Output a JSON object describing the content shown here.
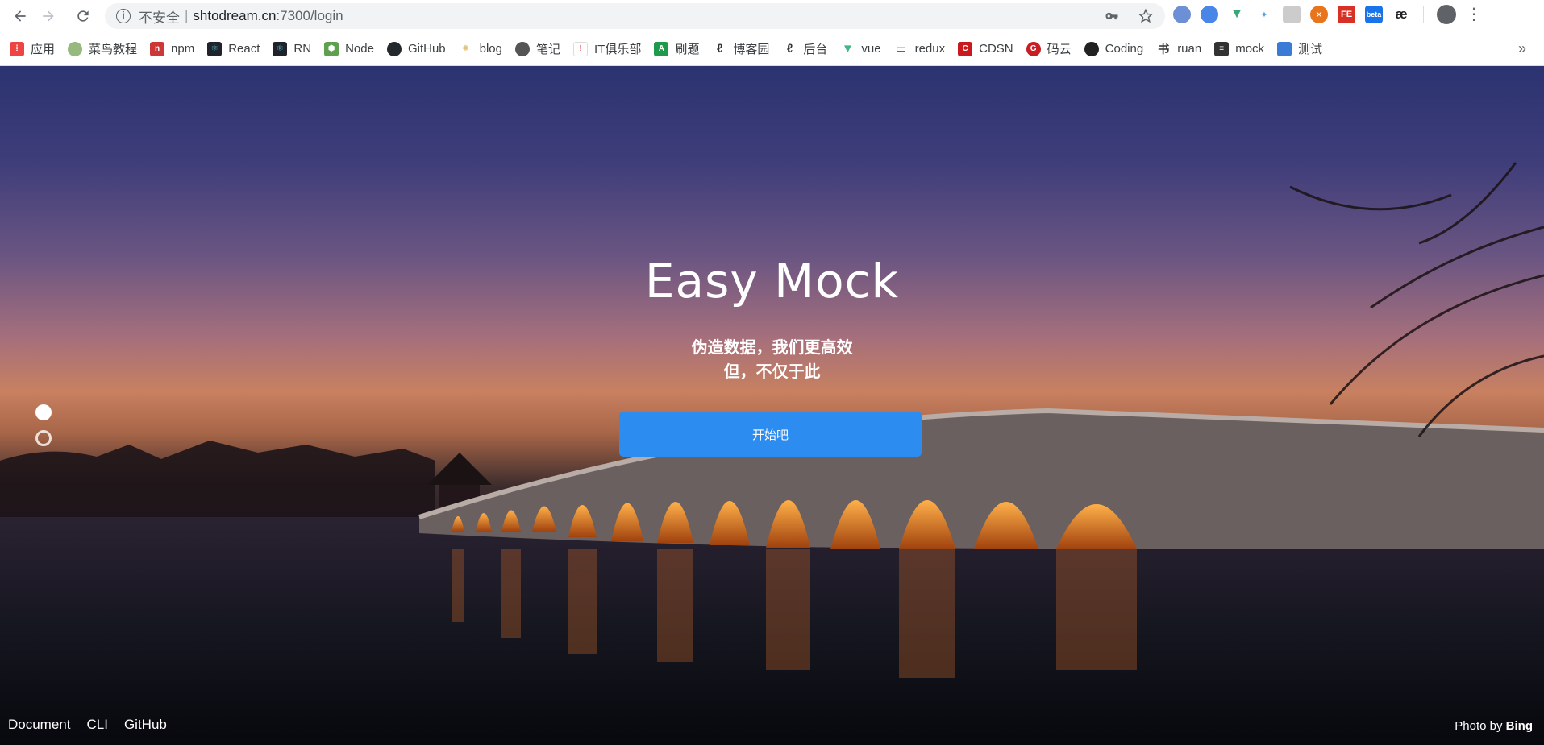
{
  "browser": {
    "security_label": "不安全",
    "separator": "|",
    "url_host": "shtodream.cn",
    "url_path": ":7300/login",
    "extensions": [
      {
        "name": "ext-1",
        "color": "#6d8fd6",
        "label": ""
      },
      {
        "name": "ext-2",
        "color": "#4a86e8",
        "label": ""
      },
      {
        "name": "ext-vue",
        "color": "#3aa776",
        "label": "V"
      },
      {
        "name": "ext-4",
        "color": "#5aa0d6",
        "label": ""
      },
      {
        "name": "ext-5",
        "color": "#bbbbbb",
        "label": ""
      },
      {
        "name": "ext-6",
        "color": "#e8741c",
        "label": ""
      },
      {
        "name": "ext-fe",
        "color": "#d93025",
        "label": "FE"
      },
      {
        "name": "ext-beta",
        "color": "#3c9fe0",
        "label": "beta"
      },
      {
        "name": "ext-ae",
        "color": "#ffffff",
        "label": "æ"
      }
    ]
  },
  "bookmarks": [
    {
      "label": "应用",
      "icon": "apps-icon",
      "color": "#e44"
    },
    {
      "label": "菜鸟教程",
      "icon": "runoob-icon",
      "color": "#96b97d"
    },
    {
      "label": "npm",
      "icon": "npm-icon",
      "color": "#cb3837"
    },
    {
      "label": "React",
      "icon": "react-icon",
      "color": "#20232a"
    },
    {
      "label": "RN",
      "icon": "react-native-icon",
      "color": "#20232a"
    },
    {
      "label": "Node",
      "icon": "node-icon",
      "color": "#5fa04e"
    },
    {
      "label": "GitHub",
      "icon": "github-icon",
      "color": "#24292e"
    },
    {
      "label": "blog",
      "icon": "blog-icon",
      "color": "#e0c070"
    },
    {
      "label": "笔记",
      "icon": "globe-icon",
      "color": "#555"
    },
    {
      "label": "IT俱乐部",
      "icon": "itclub-icon",
      "color": "#e55"
    },
    {
      "label": "刷题",
      "icon": "leetcode-icon",
      "color": "#1f9a4a"
    },
    {
      "label": "博客园",
      "icon": "cnblogs-icon",
      "color": "#333"
    },
    {
      "label": "后台",
      "icon": "admin-icon",
      "color": "#333"
    },
    {
      "label": "vue",
      "icon": "vue-icon",
      "color": "#41b883"
    },
    {
      "label": "redux",
      "icon": "book-icon",
      "color": "#333"
    },
    {
      "label": "CDSN",
      "icon": "csdn-icon",
      "color": "#c9181e"
    },
    {
      "label": "码云",
      "icon": "gitee-icon",
      "color": "#c71d23"
    },
    {
      "label": "Coding",
      "icon": "coding-icon",
      "color": "#222"
    },
    {
      "label": "ruan",
      "icon": "ruan-icon",
      "color": "#333"
    },
    {
      "label": "mock",
      "icon": "mock-icon",
      "color": "#333"
    },
    {
      "label": "测试",
      "icon": "test-icon",
      "color": "#3a7bd5"
    }
  ],
  "bookmarks_overflow": "»",
  "hero": {
    "title": "Easy Mock",
    "subtitle_line1": "伪造数据，我们更高效",
    "subtitle_line2": "但，不仅于此",
    "start_button": "开始吧"
  },
  "footer": {
    "links": [
      "Document",
      "CLI",
      "GitHub"
    ],
    "credit_prefix": "Photo by",
    "credit_name": "Bing"
  },
  "colors": {
    "primary_button": "#2d8cf0",
    "hero_text": "#ffffff"
  }
}
